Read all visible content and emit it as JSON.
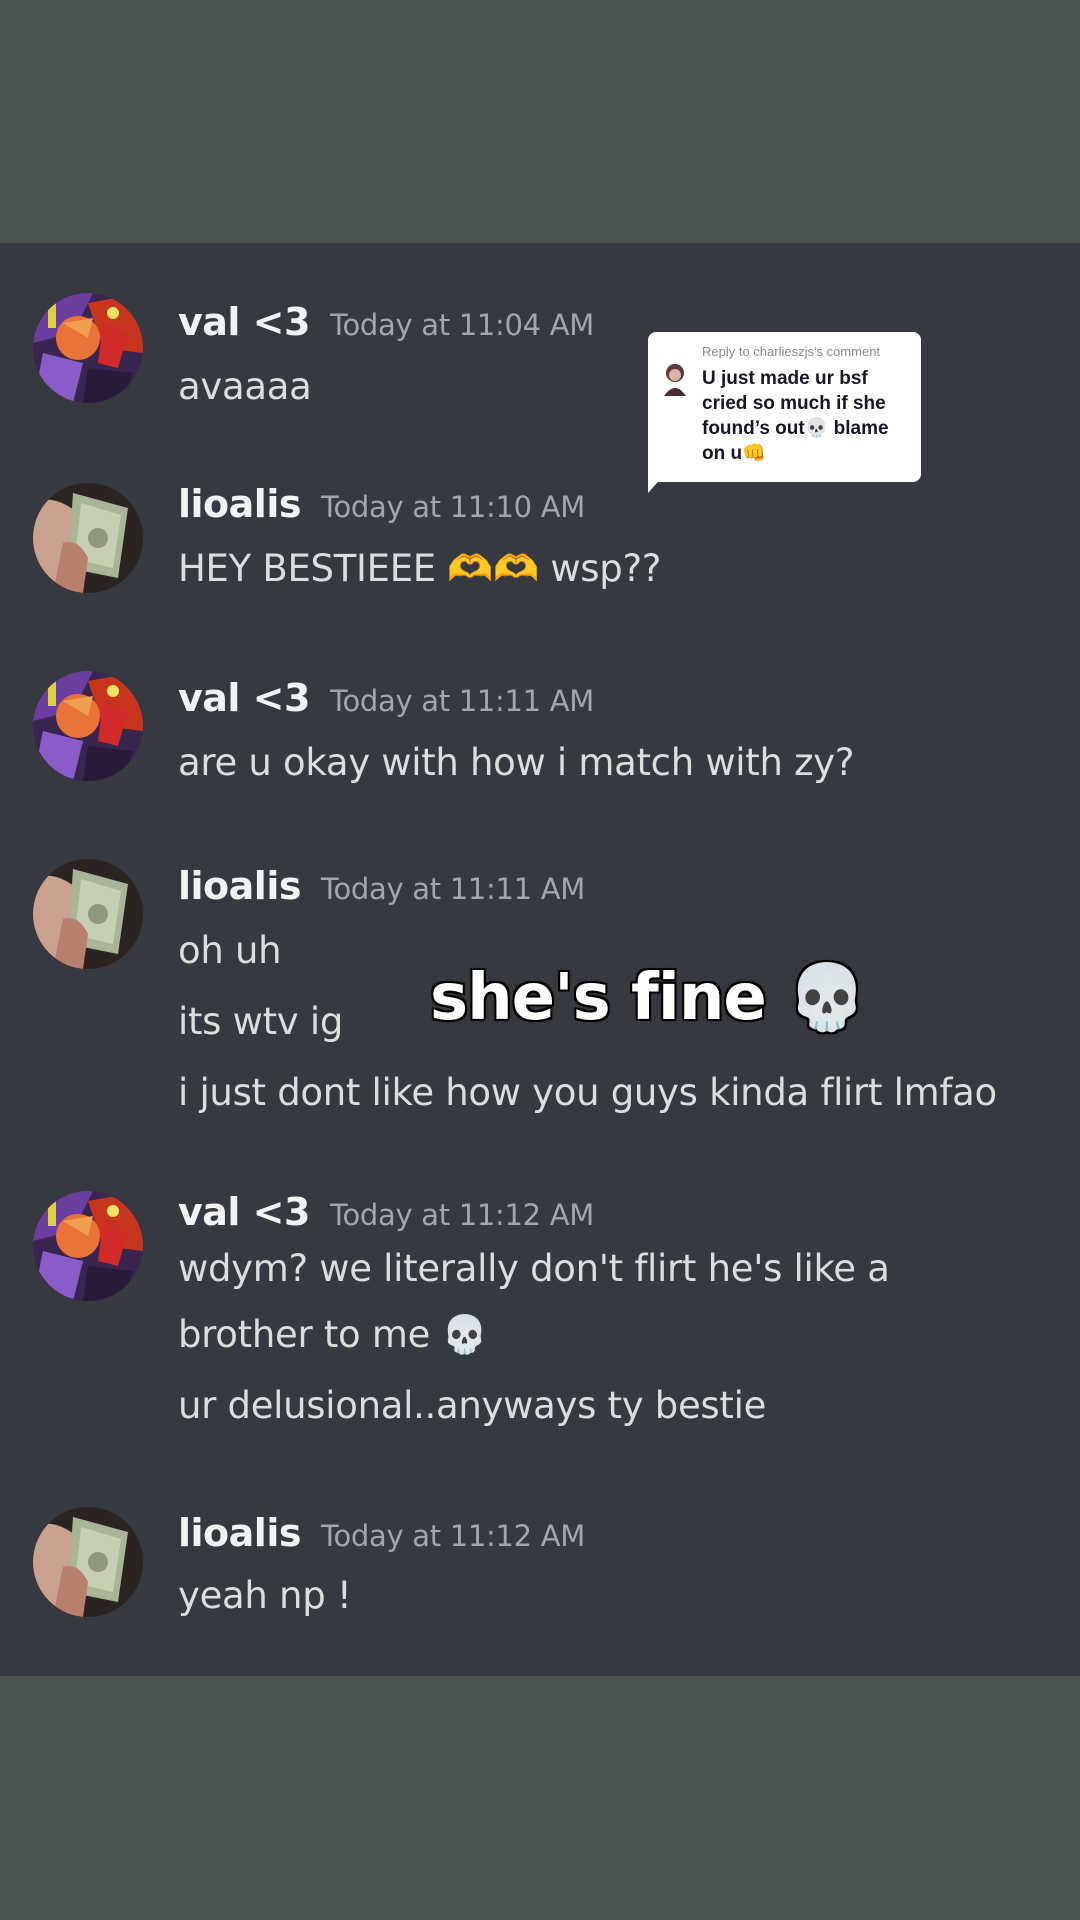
{
  "messages": [
    {
      "username": "val <3",
      "timestamp": "Today at 11:04 AM",
      "lines": [
        "avaaaa"
      ]
    },
    {
      "username": "lioalis",
      "timestamp": "Today at 11:10 AM",
      "lines": [
        "HEY BESTIEEE 🫶🫶 wsp??"
      ]
    },
    {
      "username": "val <3",
      "timestamp": "Today at 11:11 AM",
      "lines": [
        "are u okay with how i match with zy?"
      ]
    },
    {
      "username": "lioalis",
      "timestamp": "Today at 11:11 AM",
      "lines": [
        "oh uh",
        "its wtv ig",
        "i just dont like how you guys kinda flirt lmfao"
      ]
    },
    {
      "username": "val <3",
      "timestamp": "Today at 11:12 AM",
      "lines": [
        "wdym? we literally don't flirt he's like a",
        "brother to me 💀",
        "ur delusional..anyways ty bestie"
      ]
    },
    {
      "username": "lioalis",
      "timestamp": "Today at 11:12 AM",
      "lines": [
        "yeah np !"
      ]
    }
  ],
  "reply_sticker": {
    "label": "Reply to charlieszjs's comment",
    "text": "U just made ur bsf cried so much if she found’s out💀 blame on u👊"
  },
  "overlay_caption": "she's fine 💀",
  "colors": {
    "page_background": "#4b5352",
    "chat_background": "#36393f",
    "username": "#f2f3f5",
    "timestamp": "#a3a6aa",
    "message_text": "#dcddde"
  }
}
